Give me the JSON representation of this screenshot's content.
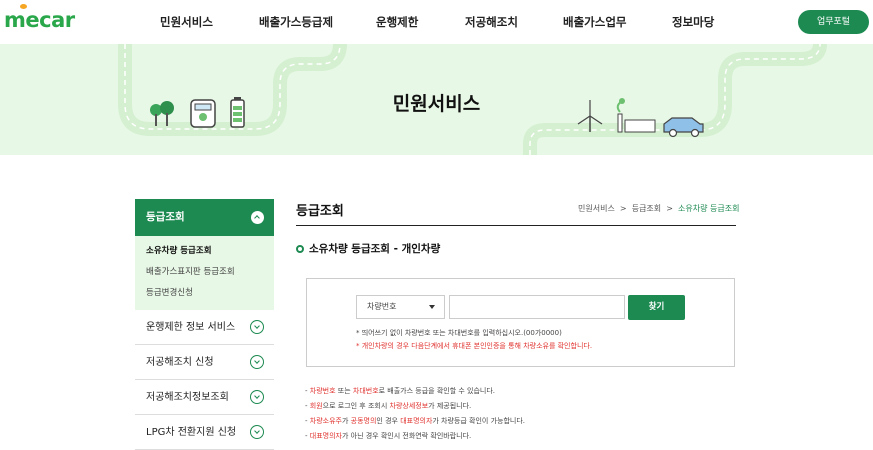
{
  "header": {
    "logo": "mecar",
    "nav": [
      "민원서비스",
      "배출가스등급제",
      "운행제한",
      "저공해조치",
      "배출가스업무",
      "정보마당"
    ],
    "work_portal": "업무포털"
  },
  "banner": {
    "title": "민원서비스"
  },
  "sidebar": {
    "active_title": "등급조회",
    "sub_items": [
      "소유차량 등급조회",
      "배출가스표지판 등급조회",
      "등급변경신청"
    ],
    "items": [
      "운행제한 정보 서비스",
      "저공해조치 신청",
      "저공해조치정보조회",
      "LPG차 전환지원 신청"
    ]
  },
  "content": {
    "title": "등급조회",
    "breadcrumb": [
      "민원서비스",
      "등급조회",
      "소유차량 등급조회"
    ],
    "section_title": "소유차량 등급조회 - 개인차량"
  },
  "search": {
    "select_value": "차량번호",
    "input_value": "",
    "button": "찾기",
    "note1": "* 띄어쓰기 없이 차량번호 또는 차대번호를 입력하십시오.(00가0000)",
    "note2": "* 개인차량의 경우 다음단계에서 휴대폰 본인인증을 통해 차량소유를 확인합니다."
  },
  "notes": [
    [
      {
        "t": "- "
      },
      {
        "t": "차량번호",
        "red": true
      },
      {
        "t": " 또는 "
      },
      {
        "t": "차대번호",
        "red": true
      },
      {
        "t": "로 배출가스 등급을 확인할 수 있습니다."
      }
    ],
    [
      {
        "t": "- "
      },
      {
        "t": "회원",
        "red": true
      },
      {
        "t": "으로 로그인 후 조회시 "
      },
      {
        "t": "차량상세정보",
        "red": true
      },
      {
        "t": "가 제공됩니다."
      }
    ],
    [
      {
        "t": "- "
      },
      {
        "t": "차량소유주",
        "red": true
      },
      {
        "t": "가 "
      },
      {
        "t": "공동명의",
        "red": true
      },
      {
        "t": "인 경우 "
      },
      {
        "t": "대표명의자",
        "red": true
      },
      {
        "t": "가 차량등급 확인이 가능합니다."
      }
    ],
    [
      {
        "t": "- "
      },
      {
        "t": "대표명의자",
        "red": true
      },
      {
        "t": "가 아닌 경우 확인시 전화연락 확인바랍니다."
      }
    ]
  ],
  "colors": {
    "brand_green": "#1d8a52",
    "banner_bg": "#e8f8e6",
    "alert_red": "#e0322e"
  }
}
